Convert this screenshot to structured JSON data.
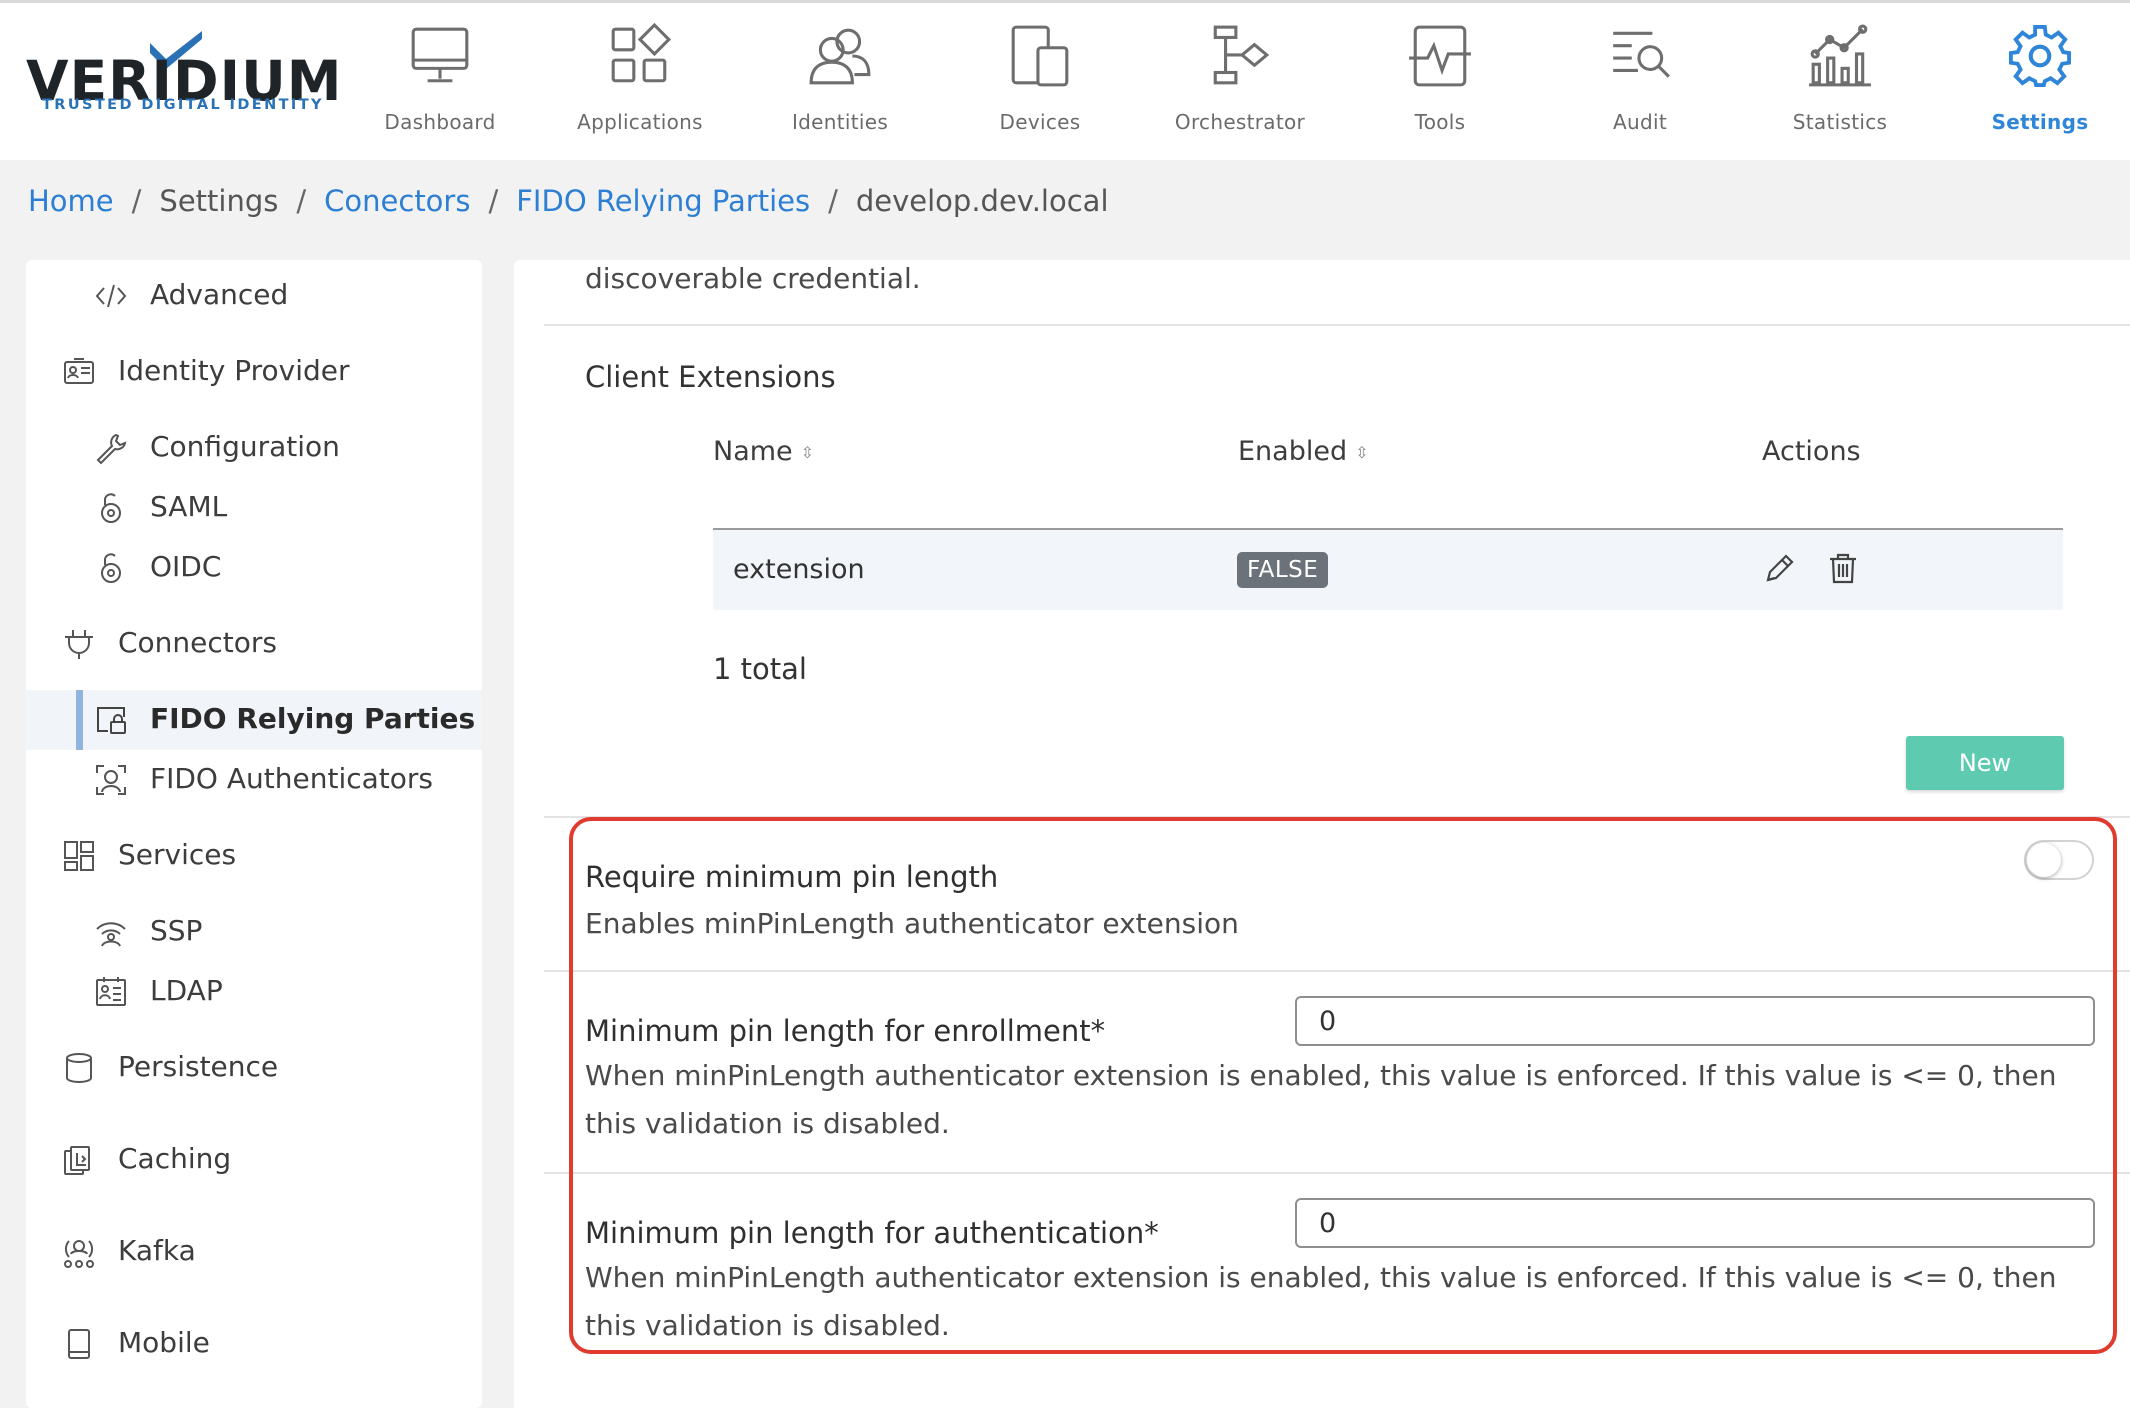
{
  "brand": {
    "name": "VERIDIUM",
    "tagline": "TRUSTED DIGITAL IDENTITY",
    "check_color": "#2a72b5"
  },
  "nav": {
    "active": "settings",
    "accent_color": "#2f86d8",
    "items": [
      {
        "label": "Dashboard",
        "icon": "monitor-icon"
      },
      {
        "label": "Applications",
        "icon": "apps-grid-icon"
      },
      {
        "label": "Identities",
        "icon": "users-icon"
      },
      {
        "label": "Devices",
        "icon": "devices-icon"
      },
      {
        "label": "Orchestrator",
        "icon": "flow-icon"
      },
      {
        "label": "Tools",
        "icon": "pulse-icon"
      },
      {
        "label": "Audit",
        "icon": "list-search-icon"
      },
      {
        "label": "Statistics",
        "icon": "stats-icon"
      },
      {
        "label": "Settings",
        "icon": "gear-icon"
      }
    ]
  },
  "breadcrumb": {
    "items": [
      {
        "label": "Home",
        "link": true
      },
      {
        "label": "Settings",
        "link": false
      },
      {
        "label": "Conectors",
        "link": true
      },
      {
        "label": "FIDO Relying Parties",
        "link": true
      },
      {
        "label": "develop.dev.local",
        "link": false
      }
    ],
    "separator": "/"
  },
  "sidebar": {
    "items": [
      {
        "label": "Advanced",
        "icon": "code-icon",
        "level": 2
      },
      {
        "label": "Identity Provider",
        "icon": "id-card-icon",
        "level": 1
      },
      {
        "label": "Configuration",
        "icon": "wrench-icon",
        "level": 2
      },
      {
        "label": "SAML",
        "icon": "key-lock-icon",
        "level": 2
      },
      {
        "label": "OIDC",
        "icon": "key-lock-icon",
        "level": 2
      },
      {
        "label": "Connectors",
        "icon": "plug-icon",
        "level": 1
      },
      {
        "label": "FIDO Relying Parties",
        "icon": "fido-lock-icon",
        "level": 2,
        "active": true
      },
      {
        "label": "FIDO Authenticators",
        "icon": "face-scan-icon",
        "level": 2
      },
      {
        "label": "Services",
        "icon": "services-grid-icon",
        "level": 1
      },
      {
        "label": "SSP",
        "icon": "wifi-user-icon",
        "level": 2
      },
      {
        "label": "LDAP",
        "icon": "directory-icon",
        "level": 2
      },
      {
        "label": "Persistence",
        "icon": "database-icon",
        "level": 1
      },
      {
        "label": "Caching",
        "icon": "cache-icon",
        "level": 1
      },
      {
        "label": "Kafka",
        "icon": "kafka-icon",
        "level": 1
      },
      {
        "label": "Mobile",
        "icon": "mobile-icon",
        "level": 1
      }
    ]
  },
  "main": {
    "top_desc": "discoverable credential.",
    "client_extensions": {
      "title": "Client Extensions",
      "columns": {
        "name": "Name",
        "enabled": "Enabled",
        "actions": "Actions"
      },
      "sort_glyph": "⇳",
      "rows": [
        {
          "name": "extension",
          "enabled": "FALSE"
        }
      ],
      "total": "1 total",
      "new_button": "New"
    },
    "require_min_pin": {
      "title": "Require minimum pin length",
      "desc": "Enables minPinLength authenticator extension",
      "enabled": false
    },
    "min_pin_enrollment": {
      "title": "Minimum pin length for enrollment*",
      "desc": "When minPinLength authenticator extension is enabled, this value is enforced. If this value is <= 0, then this validation is disabled.",
      "value": "0"
    },
    "min_pin_authentication": {
      "title": "Minimum pin length for authentication*",
      "desc": "When minPinLength authenticator extension is enabled, this value is enforced. If this value is <= 0, then this validation is disabled.",
      "value": "0"
    },
    "highlight_color": "#e03b2f"
  }
}
